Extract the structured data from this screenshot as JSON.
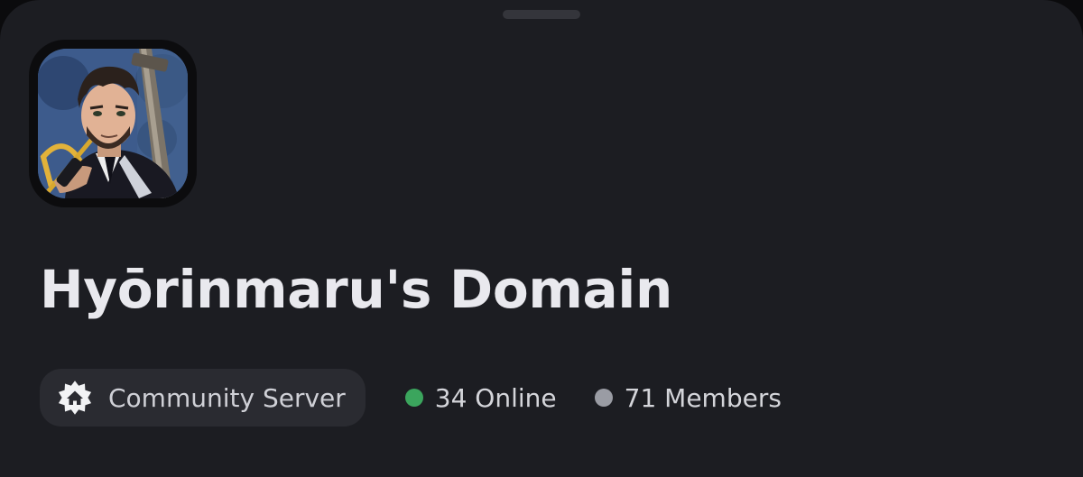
{
  "server": {
    "name": "Hyōrinmaru's Domain",
    "avatar_icon": "server-avatar-anime-portrait"
  },
  "badge": {
    "label": "Community Server",
    "icon": "community-home-icon"
  },
  "stats": {
    "online": "34 Online",
    "members": "71 Members"
  },
  "colors": {
    "background": "#1c1d22",
    "pill": "#2a2b31",
    "online_dot": "#3ba55d",
    "members_dot": "#9a9ca4",
    "title": "#e9e9ee"
  }
}
